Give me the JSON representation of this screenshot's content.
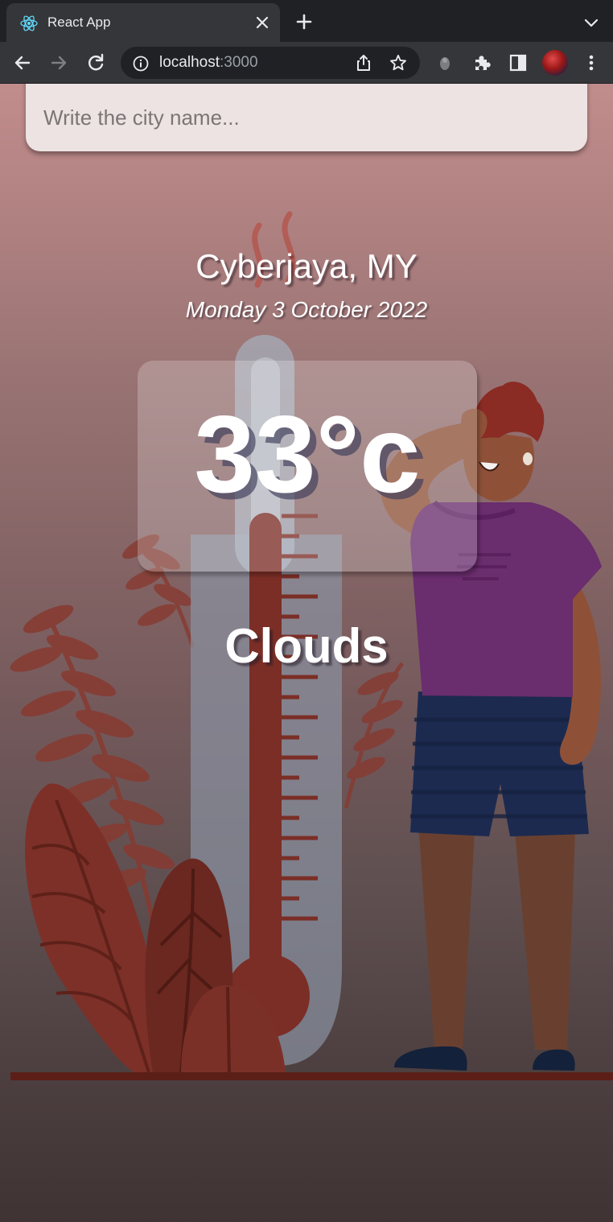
{
  "browser": {
    "tab_title": "React App",
    "url_host": "localhost",
    "url_port": ":3000"
  },
  "search": {
    "placeholder": "Write the city name..."
  },
  "weather": {
    "location": "Cyberjaya, MY",
    "date": "Monday 3 October 2022",
    "temperature": "33°c",
    "condition": "Clouds"
  }
}
